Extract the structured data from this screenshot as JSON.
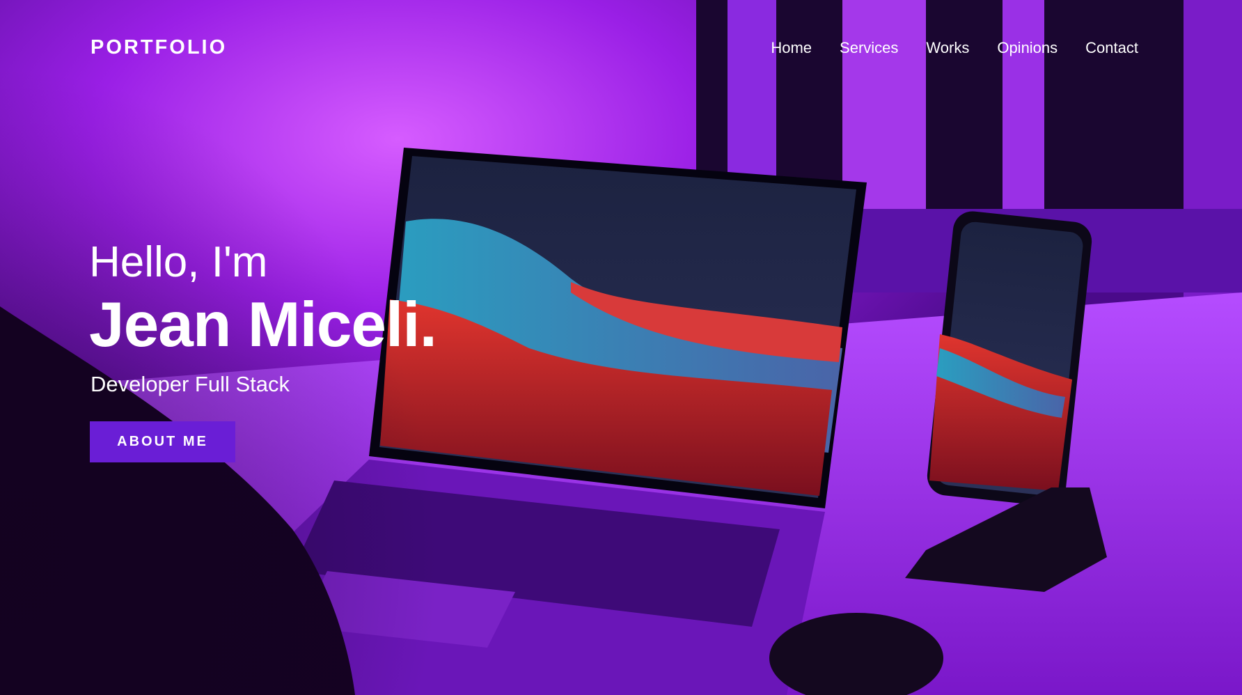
{
  "header": {
    "brand": "PORTFOLIO",
    "nav": [
      "Home",
      "Services",
      "Works",
      "Opinions",
      "Contact"
    ]
  },
  "hero": {
    "greeting": "Hello, I'm",
    "name": "Jean Miceli.",
    "role": "Developer Full Stack",
    "cta_label": "ABOUT ME"
  },
  "colors": {
    "accent": "#6a1ed6",
    "background": "#8a1ad8",
    "text": "#ffffff"
  },
  "background_image": "purple-lit desk with laptop and phone on stand"
}
